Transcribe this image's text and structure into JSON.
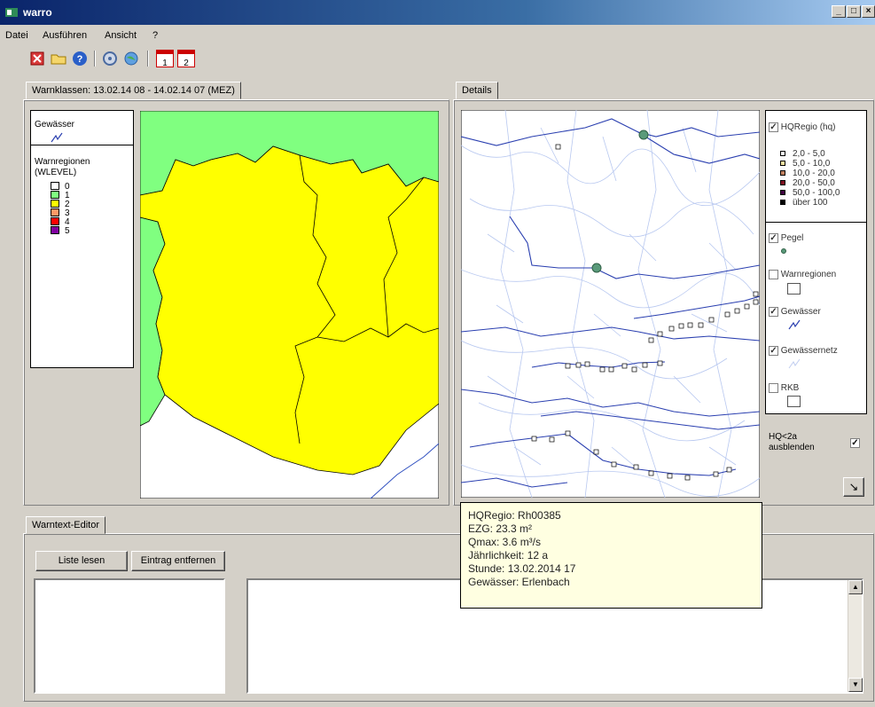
{
  "window": {
    "title": "warro",
    "min": "_",
    "max": "□",
    "close": "×"
  },
  "menu": [
    "Datei",
    "Ausführen",
    "Ansicht",
    "?"
  ],
  "toolbar": {
    "cal1": "1",
    "cal2": "2"
  },
  "left_tab": "Warnklassen: 13.02.14 08 - 14.02.14 07 (MEZ)",
  "right_tab": "Details",
  "left_legend": {
    "water_title": "Gewässer",
    "regions_title": "Warnregionen",
    "regions_sub": "(WLEVEL)",
    "levels": [
      {
        "label": "0",
        "color": "#ffffff"
      },
      {
        "label": "1",
        "color": "#80ff80"
      },
      {
        "label": "2",
        "color": "#ffff00"
      },
      {
        "label": "3",
        "color": "#ff9966"
      },
      {
        "label": "4",
        "color": "#ff0000"
      },
      {
        "label": "5",
        "color": "#8000a0"
      }
    ]
  },
  "detail_legend": {
    "hqregio_label": "HQRegio (hq)",
    "classes": [
      {
        "label": "2,0 - 5,0",
        "color": "#ffffff"
      },
      {
        "label": "5,0 - 10,0",
        "color": "#f0e0a0"
      },
      {
        "label": "10,0 - 20,0",
        "color": "#c08060"
      },
      {
        "label": "20,0 - 50,0",
        "color": "#801020"
      },
      {
        "label": "50,0 - 100,0",
        "color": "#400040"
      },
      {
        "label": "über 100",
        "color": "#000000"
      }
    ],
    "pegel_label": "Pegel",
    "warnregionen_label": "Warnregionen",
    "gewaesser_label": "Gewässer",
    "gewaessernetz_label": "Gewässernetz",
    "rkb_label": "RKB"
  },
  "hq2a": {
    "line1": "HQ<2a",
    "line2": "ausblenden",
    "checked": "✓"
  },
  "check_mark": "✓",
  "arrow_button": "↘",
  "tooltip": {
    "line1": "HQRegio: Rh00385",
    "line2": "EZG: 23.3 m²",
    "line3": "Qmax: 3.6 m³/s",
    "line4": "Jährlichkeit: 12 a",
    "line5": "Stunde: 13.02.2014 17",
    "line6": "Gewässer: Erlenbach"
  },
  "editor_tab": "Warntext-Editor",
  "buttons": {
    "read_list": "Liste lesen",
    "remove_entry": "Eintrag entfernen"
  },
  "scroll": {
    "up": "▲",
    "down": "▼"
  }
}
